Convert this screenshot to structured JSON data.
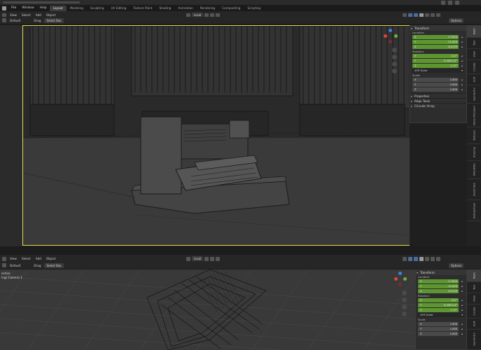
{
  "menu": {
    "items": [
      "File",
      "Window",
      "Help"
    ],
    "workspaces": [
      {
        "label": "Layout",
        "active": true
      },
      {
        "label": "Modeling",
        "active": false
      },
      {
        "label": "Sculpting",
        "active": false
      },
      {
        "label": "UV Editing",
        "active": false
      },
      {
        "label": "Texture Paint",
        "active": false
      },
      {
        "label": "Shading",
        "active": false
      },
      {
        "label": "Animation",
        "active": false
      },
      {
        "label": "Rendering",
        "active": false
      },
      {
        "label": "Compositing",
        "active": false
      },
      {
        "label": "Scripting",
        "active": false
      }
    ]
  },
  "top_view": {
    "header": {
      "menus": [
        "View",
        "Select",
        "Add",
        "Object"
      ],
      "orientation": "Default",
      "drag_label": "Drag",
      "select_mode": "Select Box",
      "transform_space": "Local",
      "options_label": "Options"
    },
    "panel": {
      "transform_title": "Transform",
      "location_label": "Location:",
      "location": [
        {
          "axis": "X",
          "value": "0.7404"
        },
        {
          "axis": "Y",
          "value": "-21.809"
        },
        {
          "axis": "Z",
          "value": "6.2159"
        }
      ],
      "rotation_label": "Rotation:",
      "rotation": [
        {
          "axis": "X",
          "value": "111°"
        },
        {
          "axis": "Y",
          "value": "0.000114°"
        },
        {
          "axis": "Z",
          "value": "1.71°"
        }
      ],
      "rotation_mode": "XYZ Euler",
      "scale_label": "Scale:",
      "scale": [
        {
          "axis": "X",
          "value": "1.000"
        },
        {
          "axis": "Y",
          "value": "1.000"
        },
        {
          "axis": "Z",
          "value": "1.000"
        }
      ],
      "sections": [
        "Properties",
        "Align Tools",
        "Circular Array"
      ]
    },
    "side_tabs": [
      "Item",
      "Tool",
      "View",
      "Create",
      "Edit",
      "Geometry",
      "Node Wrangler",
      "Textools",
      "Shading",
      "MACHIN3",
      "Sketchfab",
      "RetopoFlow"
    ]
  },
  "bottom_view": {
    "header": {
      "menus": [
        "View",
        "Select",
        "Add",
        "Object"
      ],
      "orientation": "Default",
      "drag_label": "Drag",
      "select_mode": "Select Box",
      "transform_space": "Local",
      "options_label": "Options"
    },
    "overlay": {
      "line1": "ective",
      "line2": "ing) Camera 1"
    },
    "panel": {
      "transform_title": "Transform",
      "location_label": "Location:",
      "location": [
        {
          "axis": "X",
          "value": "0.7404"
        },
        {
          "axis": "Y",
          "value": "-21.809"
        },
        {
          "axis": "Z",
          "value": "6.2159"
        }
      ],
      "rotation_label": "Rotation:",
      "rotation": [
        {
          "axis": "X",
          "value": "111°"
        },
        {
          "axis": "Y",
          "value": "0.000114°"
        },
        {
          "axis": "Z",
          "value": "1.71°"
        }
      ],
      "rotation_mode": "XYZ Euler",
      "scale_label": "Scale:",
      "scale": [
        {
          "axis": "X",
          "value": "1.000"
        },
        {
          "axis": "Y",
          "value": "1.000"
        },
        {
          "axis": "Z",
          "value": "1.000"
        }
      ]
    }
  },
  "colors": {
    "accent_active_field": "#5d9630",
    "viewport_border": "#e8d84a",
    "tool_active": "#5680c2",
    "gizmo_x": "#e0423f",
    "gizmo_y": "#6bb33d",
    "gizmo_z": "#3f7fdc"
  }
}
